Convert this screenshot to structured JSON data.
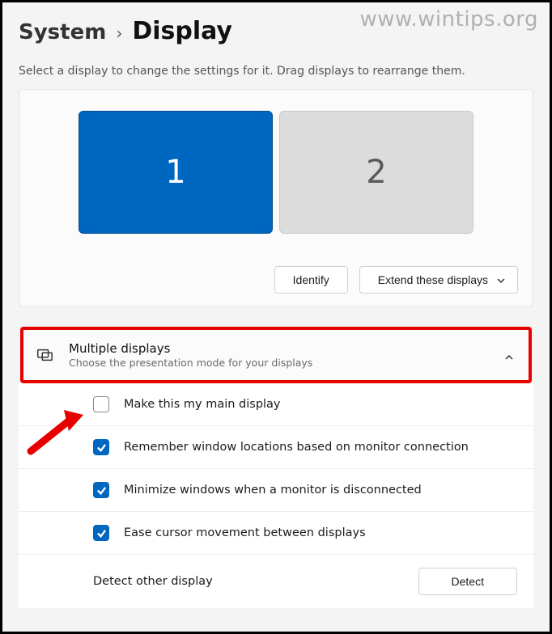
{
  "watermark": "www.wintips.org",
  "breadcrumb": {
    "system": "System",
    "separator": "›",
    "page": "Display"
  },
  "helper": "Select a display to change the settings for it. Drag displays to rearrange them.",
  "monitors": {
    "primary": "1",
    "secondary": "2"
  },
  "actions": {
    "identify": "Identify",
    "extend": "Extend these displays"
  },
  "multiple": {
    "title": "Multiple displays",
    "subtitle": "Choose the presentation mode for your displays"
  },
  "options": {
    "main": "Make this my main display",
    "remember": "Remember window locations based on monitor connection",
    "minimize": "Minimize windows when a monitor is disconnected",
    "ease": "Ease cursor movement between displays",
    "detect_label": "Detect other display",
    "detect_btn": "Detect"
  }
}
